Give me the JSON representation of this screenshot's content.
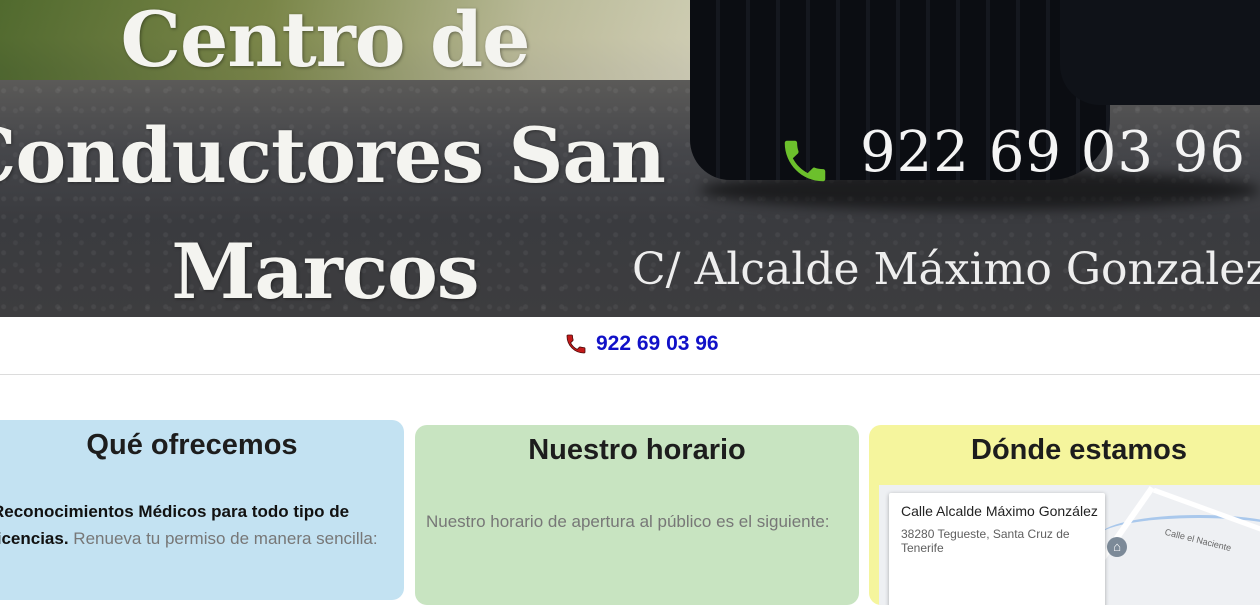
{
  "hero": {
    "title_line1": "Centro de",
    "title_line2": "Conductores San",
    "title_line3": "Marcos",
    "phone": "922 69 03 96",
    "address": "C/ Alcalde Máximo Gonzalez"
  },
  "phone_bar": {
    "phone": "922 69 03 96",
    "link_color": "#1111c8"
  },
  "cards": {
    "offer": {
      "title": "Qué ofrecemos",
      "bold_text": "Reconocimientos Médicos para todo tipo de licencias.",
      "text": "Renueva tu permiso de manera sencilla:"
    },
    "hours": {
      "title": "Nuestro horario",
      "text": "Nuestro horario de apertura al público es el siguiente:"
    },
    "where": {
      "title": "Dónde estamos",
      "map_place_name": "Calle Alcalde Máximo González",
      "map_place_address": "38280 Tegueste, Santa Cruz de Tenerife",
      "map_road_label": "Calle el Naciente"
    }
  },
  "colors": {
    "offer_bg": "#c3e2f2",
    "hours_bg": "#c8e4c1",
    "where_bg": "#f5f59d"
  },
  "icons": {
    "hero_phone": "phone-icon",
    "bar_phone": "phone-icon"
  }
}
